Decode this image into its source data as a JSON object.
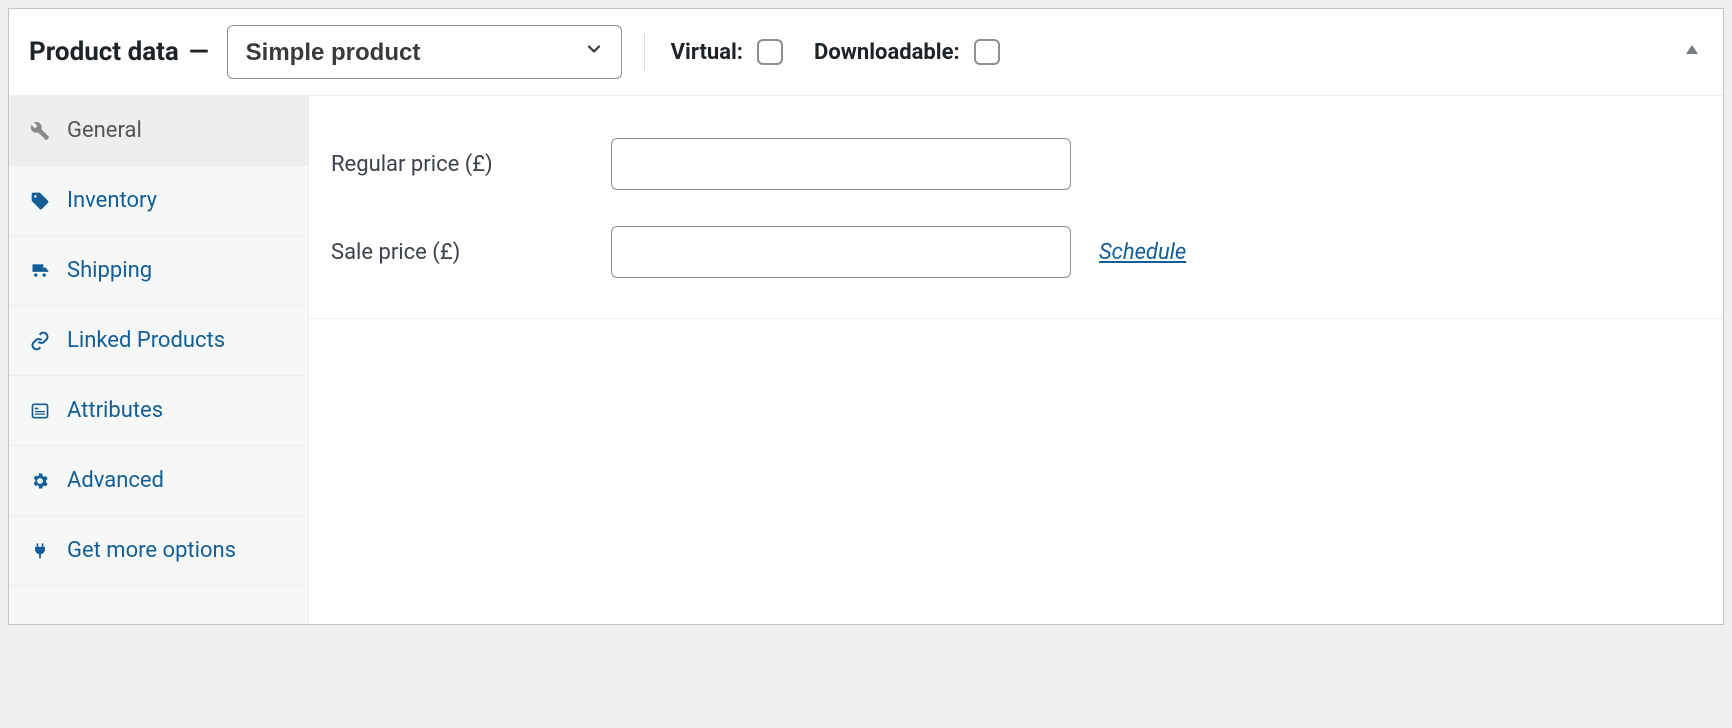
{
  "header": {
    "title": "Product data",
    "dash": "—",
    "product_type_selected": "Simple product",
    "virtual_label": "Virtual:",
    "downloadable_label": "Downloadable:"
  },
  "sidebar": {
    "items": [
      {
        "label": "General",
        "icon": "wrench",
        "active": true
      },
      {
        "label": "Inventory",
        "icon": "tag",
        "active": false
      },
      {
        "label": "Shipping",
        "icon": "truck",
        "active": false
      },
      {
        "label": "Linked Products",
        "icon": "link",
        "active": false
      },
      {
        "label": "Attributes",
        "icon": "list",
        "active": false
      },
      {
        "label": "Advanced",
        "icon": "gear",
        "active": false
      },
      {
        "label": "Get more options",
        "icon": "plug",
        "active": false
      }
    ]
  },
  "general": {
    "regular_price_label": "Regular price (£)",
    "regular_price_value": "",
    "sale_price_label": "Sale price (£)",
    "sale_price_value": "",
    "schedule_link": "Schedule"
  }
}
